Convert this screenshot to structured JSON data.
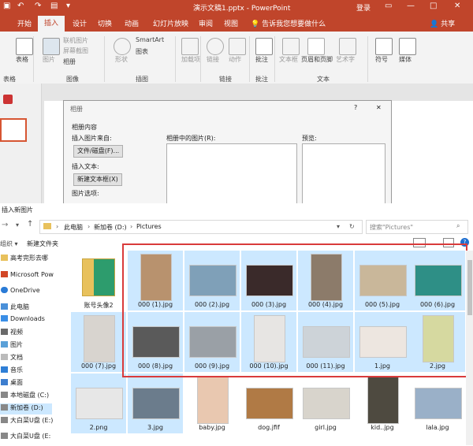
{
  "titlebar": {
    "title": "演示文稿1.pptx - PowerPoint",
    "login": "登录",
    "restore_icon": "▭",
    "minimize_icon": "—",
    "maximize_icon": "□",
    "close_icon": "✕"
  },
  "tabs": [
    "开始",
    "插入",
    "设计",
    "切换",
    "动画",
    "幻灯片放映",
    "审阅",
    "视图"
  ],
  "active_tab": "插入",
  "tell_me": "告诉我您想要做什么",
  "share": "共享",
  "ribbon": {
    "items": {
      "table": "表格",
      "image": "图片",
      "online_image": "联机图片",
      "screenshot": "屏幕截图",
      "album": "相册",
      "shapes": "形状",
      "smartart": "SmartArt",
      "chart": "图表",
      "addins": "加载项",
      "link": "链接",
      "action": "动作",
      "comment": "批注",
      "textbox": "文本框",
      "header_footer": "页眉和页脚",
      "wordart": "艺术字",
      "symbol": "符号",
      "media": "媒体"
    },
    "groups": {
      "tables": "表格",
      "images": "图像",
      "illustrations": "插图",
      "links": "链接",
      "comments": "批注",
      "text": "文本"
    }
  },
  "album_dialog": {
    "title": "相册",
    "help": "?",
    "close": "✕",
    "album_content": "相册内容",
    "insert_from": "插入图片来自:",
    "file_disk_btn": "文件/磁盘(F)...",
    "insert_text": "插入文本:",
    "new_textbox_btn": "新建文本框(X)",
    "picture_options": "图片选项:",
    "pictures_in_album": "相册中的图片(R):",
    "preview": "预览:"
  },
  "insert_dialog": {
    "title": "插入新图片",
    "breadcrumbs": [
      "此电脑",
      "新加卷 (D:)",
      "Pictures"
    ],
    "search_placeholder": "搜索\"Pictures\"",
    "organize": "组织 ▾",
    "new_folder": "新建文件夹",
    "nav": [
      "高考完形去哪",
      "Microsoft Pow",
      "OneDrive",
      "此电脑",
      "Downloads",
      "视频",
      "图片",
      "文档",
      "音乐",
      "桌面",
      "本地磁盘 (C:)",
      "新加卷 (D:)",
      "大白菜U盘 (E:)",
      "大白菜U盘 (E:"
    ],
    "files": [
      {
        "name": "账号头像2",
        "kind": "folder",
        "selected": false
      },
      {
        "name": "000 (1).jpg",
        "color": "#b8926e",
        "selected": true
      },
      {
        "name": "000 (2).jpg",
        "color": "#7fa0b8",
        "selected": true
      },
      {
        "name": "000 (3).jpg",
        "color": "#3a2a2a",
        "selected": true
      },
      {
        "name": "000 (4).jpg",
        "color": "#8c7b6a",
        "selected": true
      },
      {
        "name": "000 (5).jpg",
        "color": "#c9b79a",
        "selected": true
      },
      {
        "name": "000 (6).jpg",
        "color": "#2e8f86",
        "selected": true
      },
      {
        "name": "000 (7).jpg",
        "color": "#d8d4cf",
        "selected": true
      },
      {
        "name": "000 (8).jpg",
        "color": "#5a5a5a",
        "selected": true
      },
      {
        "name": "000 (9).jpg",
        "color": "#9aa0a6",
        "selected": true
      },
      {
        "name": "000 (10).jpg",
        "color": "#e7e5e3",
        "selected": true
      },
      {
        "name": "000 (11).jpg",
        "color": "#cdd3d8",
        "selected": true
      },
      {
        "name": "1.jpg",
        "color": "#ede6e0",
        "selected": true
      },
      {
        "name": "2.jpg",
        "color": "#d6d9a0",
        "selected": true
      },
      {
        "name": "2.png",
        "color": "#e7e7e7",
        "selected": true
      },
      {
        "name": "3.jpg",
        "color": "#6b7c8c",
        "selected": true
      },
      {
        "name": "baby.jpg",
        "color": "#e9c8b0",
        "selected": false
      },
      {
        "name": "dog.jfif",
        "color": "#b07a45",
        "selected": false
      },
      {
        "name": "girl.jpg",
        "color": "#d8d4cc",
        "selected": false
      },
      {
        "name": "kid..jpg",
        "color": "#4e4a40",
        "selected": false
      },
      {
        "name": "lala.jpg",
        "color": "#9ab0c8",
        "selected": false
      }
    ]
  },
  "colors": {
    "accent": "#c0452b",
    "selection": "#cce8ff",
    "highlight_border": "#d93b3b"
  }
}
